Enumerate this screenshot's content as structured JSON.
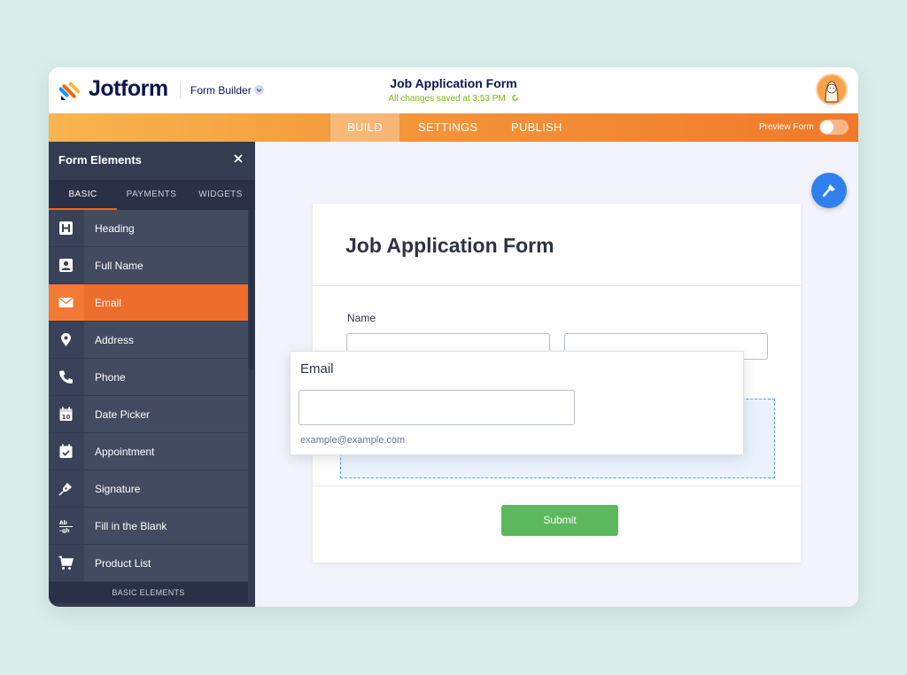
{
  "app": {
    "brand": "Jotform",
    "mode": "Form Builder",
    "document_title": "Job Application Form",
    "save_status": "All changes saved at 3:53 PM"
  },
  "nav": {
    "tabs": [
      {
        "label": "BUILD",
        "active": true
      },
      {
        "label": "SETTINGS",
        "active": false
      },
      {
        "label": "PUBLISH",
        "active": false
      }
    ],
    "preview_label": "Preview Form",
    "preview_on": false
  },
  "sidebar": {
    "title": "Form Elements",
    "tabs": [
      {
        "label": "BASIC",
        "active": true
      },
      {
        "label": "PAYMENTS",
        "active": false
      },
      {
        "label": "WIDGETS",
        "active": false
      }
    ],
    "items": [
      {
        "label": "Heading",
        "icon": "heading-icon"
      },
      {
        "label": "Full Name",
        "icon": "user-card-icon"
      },
      {
        "label": "Email",
        "icon": "envelope-icon",
        "active": true
      },
      {
        "label": "Address",
        "icon": "map-pin-icon"
      },
      {
        "label": "Phone",
        "icon": "phone-icon"
      },
      {
        "label": "Date Picker",
        "icon": "calendar-icon"
      },
      {
        "label": "Appointment",
        "icon": "calendar-check-icon"
      },
      {
        "label": "Signature",
        "icon": "pen-nib-icon"
      },
      {
        "label": "Fill in the Blank",
        "icon": "fill-blank-icon"
      },
      {
        "label": "Product List",
        "icon": "cart-icon"
      }
    ],
    "footer": "BASIC ELEMENTS"
  },
  "form": {
    "title": "Job Application Form",
    "name_label": "Name",
    "submit_label": "Submit"
  },
  "dragging": {
    "title": "Email",
    "sublabel": "example@example.com"
  },
  "colors": {
    "accent_orange": "#ec6d2c",
    "sidebar_bg": "#343c52",
    "submit_green": "#5cb85c",
    "fab_blue": "#2f80ed",
    "saved_green": "#78bb07"
  }
}
